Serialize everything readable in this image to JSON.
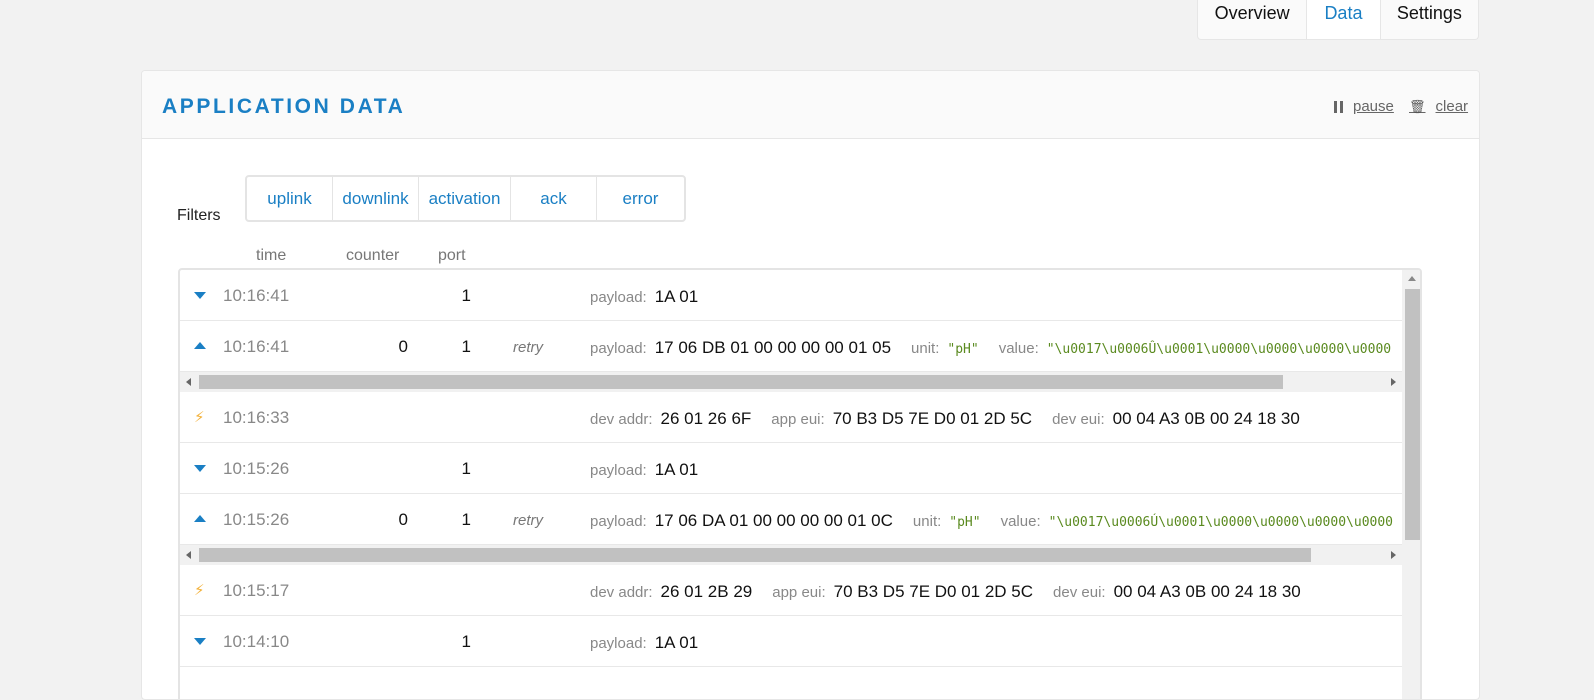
{
  "tabs": [
    {
      "label": "Overview",
      "active": false
    },
    {
      "label": "Data",
      "active": true
    },
    {
      "label": "Settings",
      "active": false
    }
  ],
  "panel": {
    "title": "APPLICATION DATA",
    "pause_label": "pause",
    "clear_label": "clear"
  },
  "filters": {
    "label": "Filters",
    "buttons": [
      "uplink",
      "downlink",
      "activation",
      "ack",
      "error"
    ]
  },
  "columns": {
    "time": "time",
    "counter": "counter",
    "port": "port"
  },
  "rows": [
    {
      "kind": "downlink",
      "time": "10:16:41",
      "counter": "",
      "port": "1",
      "tag": "",
      "fields": [
        {
          "k": "payload:",
          "v": "1A 01"
        }
      ]
    },
    {
      "kind": "uplink",
      "time": "10:16:41",
      "counter": "0",
      "port": "1",
      "tag": "retry",
      "fields": [
        {
          "k": "payload:",
          "v": "17 06 DB 01 00 00 00 00 01 05"
        },
        {
          "k": "unit:",
          "v": "\"pH\"",
          "str": true
        },
        {
          "k": "value:",
          "v": "\"\\u0017\\u0006Û\\u0001\\u0000\\u0000\\u0000\\u0000",
          "str": true
        }
      ]
    },
    {
      "kind": "activation",
      "time": "10:16:33",
      "counter": "",
      "port": "",
      "tag": "",
      "fields": [
        {
          "k": "dev addr:",
          "v": "26 01 26 6F"
        },
        {
          "k": "app eui:",
          "v": "70 B3 D5 7E D0 01 2D 5C"
        },
        {
          "k": "dev eui:",
          "v": "00 04 A3 0B 00 24 18 30"
        }
      ]
    },
    {
      "kind": "downlink",
      "time": "10:15:26",
      "counter": "",
      "port": "1",
      "tag": "",
      "fields": [
        {
          "k": "payload:",
          "v": "1A 01"
        }
      ]
    },
    {
      "kind": "uplink",
      "time": "10:15:26",
      "counter": "0",
      "port": "1",
      "tag": "retry",
      "fields": [
        {
          "k": "payload:",
          "v": "17 06 DA 01 00 00 00 00 01 0C"
        },
        {
          "k": "unit:",
          "v": "\"pH\"",
          "str": true
        },
        {
          "k": "value:",
          "v": "\"\\u0017\\u0006Ú\\u0001\\u0000\\u0000\\u0000\\u0000",
          "str": true
        }
      ]
    },
    {
      "kind": "activation",
      "time": "10:15:17",
      "counter": "",
      "port": "",
      "tag": "",
      "fields": [
        {
          "k": "dev addr:",
          "v": "26 01 2B 29"
        },
        {
          "k": "app eui:",
          "v": "70 B3 D5 7E D0 01 2D 5C"
        },
        {
          "k": "dev eui:",
          "v": "00 04 A3 0B 00 24 18 30"
        }
      ]
    },
    {
      "kind": "downlink",
      "time": "10:14:10",
      "counter": "",
      "port": "1",
      "tag": "",
      "fields": [
        {
          "k": "payload:",
          "v": "1A 01"
        }
      ]
    }
  ],
  "icons": {
    "downlink": "triangle-down-icon",
    "uplink": "triangle-up-icon",
    "activation": "lightning-icon",
    "pause": "pause-icon",
    "clear": "trash-icon"
  },
  "colors": {
    "accent": "#1a7fc4",
    "string_value": "#5a8a1f",
    "activation": "#f3b23c"
  }
}
